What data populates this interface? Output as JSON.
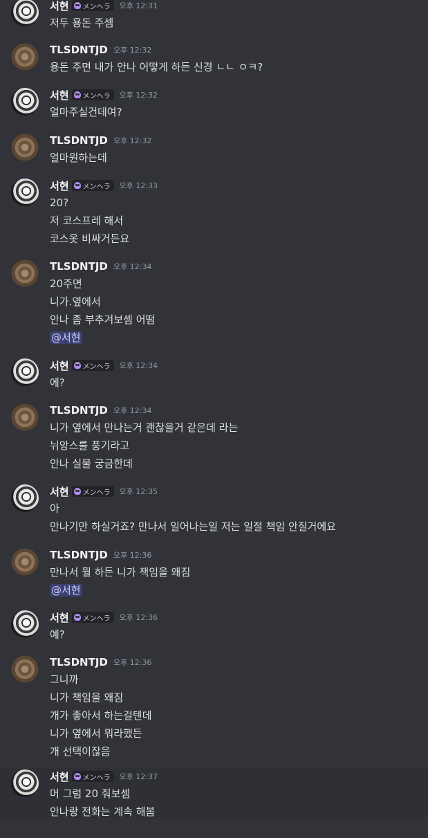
{
  "users": {
    "seohyun": {
      "name": "서현",
      "badge": "メンヘラ",
      "badge_icon": "skull-icon",
      "badge_color": "#b48cf0"
    },
    "tlsdntjd": {
      "name": "TLSDNTJD"
    }
  },
  "messages": [
    {
      "author": "서현",
      "badge": "メンヘラ",
      "time": "오후 12:31",
      "lines": [
        "저두 용돈 주셈"
      ]
    },
    {
      "author": "TLSDNTJD",
      "time": "오후 12:32",
      "lines": [
        "용돈 주면 내가 안나 어떻게 하든 신경 ㄴㄴ ㅇㅋ?"
      ]
    },
    {
      "author": "서현",
      "badge": "メンヘラ",
      "time": "오후 12:32",
      "lines": [
        "얼마주실건데여?"
      ]
    },
    {
      "author": "TLSDNTJD",
      "time": "오후 12:32",
      "lines": [
        "얼마원하는데"
      ]
    },
    {
      "author": "서현",
      "badge": "メンヘラ",
      "time": "오후 12:33",
      "lines": [
        "20?",
        "저 코스프레 해서",
        "코스옷 비싸거든요"
      ]
    },
    {
      "author": "TLSDNTJD",
      "time": "오후 12:34",
      "lines": [
        "20주면",
        "니가.옆에서",
        "안나 좀 부추겨보셈 어떰"
      ],
      "mention": "@서현"
    },
    {
      "author": "서현",
      "badge": "メンヘラ",
      "time": "오후 12:34",
      "lines": [
        "에?"
      ]
    },
    {
      "author": "TLSDNTJD",
      "time": "오후 12:34",
      "lines": [
        "니가 옆에서 만나는거 괜찮을거 같은데 라는",
        "뉘앙스를 풍기라고",
        "안나 실물 궁금한데"
      ]
    },
    {
      "author": "서현",
      "badge": "メンヘラ",
      "time": "오후 12:35",
      "lines": [
        "아",
        "만나기만 하실거죠? 만나서 일어나는일 저는 일절 책임 안질거에요"
      ]
    },
    {
      "author": "TLSDNTJD",
      "time": "오후 12:36",
      "lines": [
        "만나서 뭘 하든 니가 책임을 왜짐"
      ],
      "mention": "@서현"
    },
    {
      "author": "서현",
      "badge": "メンヘラ",
      "time": "오후 12:36",
      "lines": [
        "예?"
      ]
    },
    {
      "author": "TLSDNTJD",
      "time": "오후 12:36",
      "lines": [
        "그니까",
        "니가 책임을 왜짐",
        "개가 좋아서 하는걸텐데",
        "니가 옆에서 뭐라했든",
        "개 선택이잖음"
      ]
    },
    {
      "author": "서현",
      "badge": "メンヘラ",
      "time": "오후 12:37",
      "lines": [
        "머 그럼 20 줘보셈",
        "안나랑 전화는 계속 해봄"
      ]
    }
  ]
}
